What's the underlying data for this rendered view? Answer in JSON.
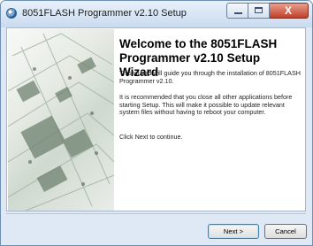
{
  "window": {
    "title": "8051FLASH Programmer v2.10 Setup",
    "close_glyph": "X"
  },
  "wizard": {
    "heading": "Welcome to the 8051FLASH Programmer v2.10 Setup Wizard",
    "paragraphs": [
      "This wizard will guide you through the installation of 8051FLASH Programmer v2.10.",
      "It is recommended that you close all other applications before starting Setup. This will make it possible to update relevant system files without having to reboot your computer.",
      "Click Next to continue."
    ]
  },
  "buttons": {
    "next": "Next >",
    "cancel": "Cancel"
  },
  "icons": {
    "app": "setup-disc-icon",
    "minimize": "minimize-icon",
    "maximize": "maximize-icon",
    "close": "close-icon"
  },
  "colors": {
    "frame": "#dfe9f5",
    "close_button": "#c0402a",
    "default_button_border": "#3c7fb1"
  }
}
